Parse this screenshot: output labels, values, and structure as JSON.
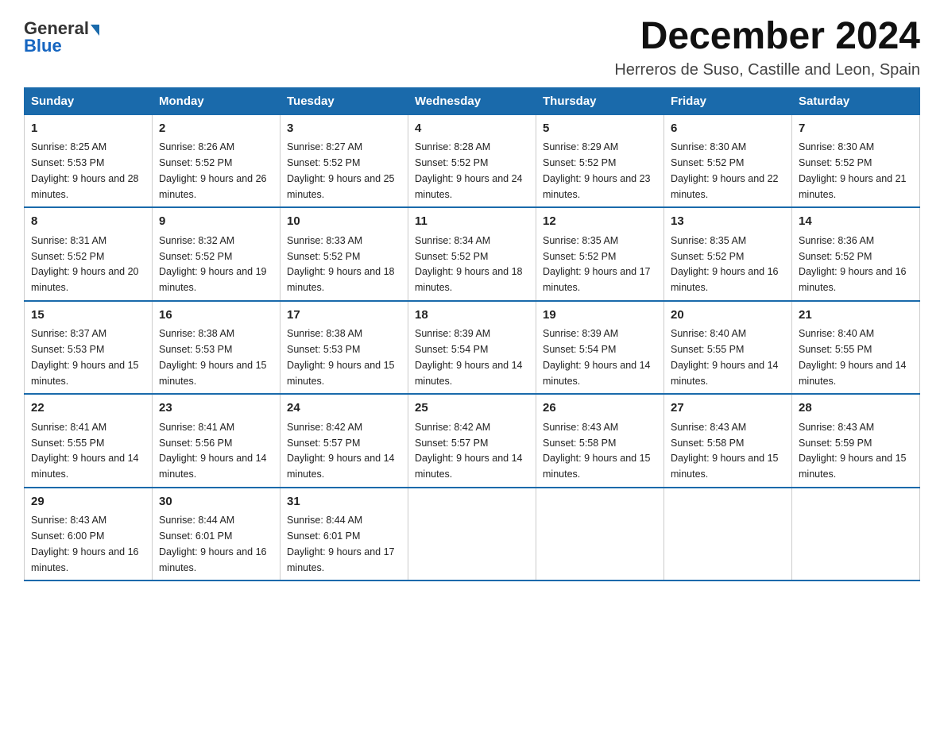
{
  "logo": {
    "general": "General",
    "blue": "Blue",
    "arrow": "▶"
  },
  "title": "December 2024",
  "location": "Herreros de Suso, Castille and Leon, Spain",
  "weekdays": [
    "Sunday",
    "Monday",
    "Tuesday",
    "Wednesday",
    "Thursday",
    "Friday",
    "Saturday"
  ],
  "weeks": [
    [
      {
        "day": "1",
        "sunrise": "8:25 AM",
        "sunset": "5:53 PM",
        "daylight": "9 hours and 28 minutes."
      },
      {
        "day": "2",
        "sunrise": "8:26 AM",
        "sunset": "5:52 PM",
        "daylight": "9 hours and 26 minutes."
      },
      {
        "day": "3",
        "sunrise": "8:27 AM",
        "sunset": "5:52 PM",
        "daylight": "9 hours and 25 minutes."
      },
      {
        "day": "4",
        "sunrise": "8:28 AM",
        "sunset": "5:52 PM",
        "daylight": "9 hours and 24 minutes."
      },
      {
        "day": "5",
        "sunrise": "8:29 AM",
        "sunset": "5:52 PM",
        "daylight": "9 hours and 23 minutes."
      },
      {
        "day": "6",
        "sunrise": "8:30 AM",
        "sunset": "5:52 PM",
        "daylight": "9 hours and 22 minutes."
      },
      {
        "day": "7",
        "sunrise": "8:30 AM",
        "sunset": "5:52 PM",
        "daylight": "9 hours and 21 minutes."
      }
    ],
    [
      {
        "day": "8",
        "sunrise": "8:31 AM",
        "sunset": "5:52 PM",
        "daylight": "9 hours and 20 minutes."
      },
      {
        "day": "9",
        "sunrise": "8:32 AM",
        "sunset": "5:52 PM",
        "daylight": "9 hours and 19 minutes."
      },
      {
        "day": "10",
        "sunrise": "8:33 AM",
        "sunset": "5:52 PM",
        "daylight": "9 hours and 18 minutes."
      },
      {
        "day": "11",
        "sunrise": "8:34 AM",
        "sunset": "5:52 PM",
        "daylight": "9 hours and 18 minutes."
      },
      {
        "day": "12",
        "sunrise": "8:35 AM",
        "sunset": "5:52 PM",
        "daylight": "9 hours and 17 minutes."
      },
      {
        "day": "13",
        "sunrise": "8:35 AM",
        "sunset": "5:52 PM",
        "daylight": "9 hours and 16 minutes."
      },
      {
        "day": "14",
        "sunrise": "8:36 AM",
        "sunset": "5:52 PM",
        "daylight": "9 hours and 16 minutes."
      }
    ],
    [
      {
        "day": "15",
        "sunrise": "8:37 AM",
        "sunset": "5:53 PM",
        "daylight": "9 hours and 15 minutes."
      },
      {
        "day": "16",
        "sunrise": "8:38 AM",
        "sunset": "5:53 PM",
        "daylight": "9 hours and 15 minutes."
      },
      {
        "day": "17",
        "sunrise": "8:38 AM",
        "sunset": "5:53 PM",
        "daylight": "9 hours and 15 minutes."
      },
      {
        "day": "18",
        "sunrise": "8:39 AM",
        "sunset": "5:54 PM",
        "daylight": "9 hours and 14 minutes."
      },
      {
        "day": "19",
        "sunrise": "8:39 AM",
        "sunset": "5:54 PM",
        "daylight": "9 hours and 14 minutes."
      },
      {
        "day": "20",
        "sunrise": "8:40 AM",
        "sunset": "5:55 PM",
        "daylight": "9 hours and 14 minutes."
      },
      {
        "day": "21",
        "sunrise": "8:40 AM",
        "sunset": "5:55 PM",
        "daylight": "9 hours and 14 minutes."
      }
    ],
    [
      {
        "day": "22",
        "sunrise": "8:41 AM",
        "sunset": "5:55 PM",
        "daylight": "9 hours and 14 minutes."
      },
      {
        "day": "23",
        "sunrise": "8:41 AM",
        "sunset": "5:56 PM",
        "daylight": "9 hours and 14 minutes."
      },
      {
        "day": "24",
        "sunrise": "8:42 AM",
        "sunset": "5:57 PM",
        "daylight": "9 hours and 14 minutes."
      },
      {
        "day": "25",
        "sunrise": "8:42 AM",
        "sunset": "5:57 PM",
        "daylight": "9 hours and 14 minutes."
      },
      {
        "day": "26",
        "sunrise": "8:43 AM",
        "sunset": "5:58 PM",
        "daylight": "9 hours and 15 minutes."
      },
      {
        "day": "27",
        "sunrise": "8:43 AM",
        "sunset": "5:58 PM",
        "daylight": "9 hours and 15 minutes."
      },
      {
        "day": "28",
        "sunrise": "8:43 AM",
        "sunset": "5:59 PM",
        "daylight": "9 hours and 15 minutes."
      }
    ],
    [
      {
        "day": "29",
        "sunrise": "8:43 AM",
        "sunset": "6:00 PM",
        "daylight": "9 hours and 16 minutes."
      },
      {
        "day": "30",
        "sunrise": "8:44 AM",
        "sunset": "6:01 PM",
        "daylight": "9 hours and 16 minutes."
      },
      {
        "day": "31",
        "sunrise": "8:44 AM",
        "sunset": "6:01 PM",
        "daylight": "9 hours and 17 minutes."
      },
      null,
      null,
      null,
      null
    ]
  ]
}
